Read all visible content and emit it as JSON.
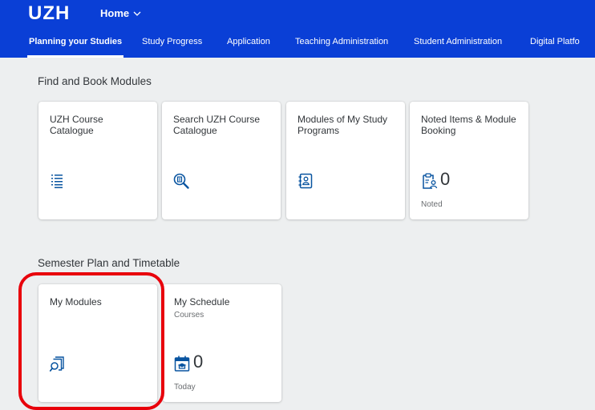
{
  "shell": {
    "logo": "UZH",
    "home_label": "Home"
  },
  "tabs": [
    {
      "label": "Planning your Studies",
      "active": true
    },
    {
      "label": "Study Progress"
    },
    {
      "label": "Application"
    },
    {
      "label": "Teaching Administration"
    },
    {
      "label": "Student Administration"
    },
    {
      "label": "Digital Platfo"
    }
  ],
  "sections": [
    {
      "title": "Find and Book Modules",
      "tiles": [
        {
          "title": "UZH Course Catalogue",
          "icon": "list-icon"
        },
        {
          "title": "Search UZH Course Catalogue",
          "icon": "search-document-icon"
        },
        {
          "title": "Modules of My Study Programs",
          "icon": "address-book-icon"
        },
        {
          "title": "Noted Items & Module Booking",
          "icon": "clipboard-user-icon",
          "number": "0",
          "footer": "Noted"
        }
      ]
    },
    {
      "title": "Semester Plan and Timetable",
      "tiles": [
        {
          "title": "My Modules",
          "icon": "module-search-icon"
        },
        {
          "title": "My Schedule",
          "subtitle": "Courses",
          "icon": "calendar-education-icon",
          "number": "0",
          "footer": "Today"
        }
      ]
    }
  ],
  "colors": {
    "brand": "#0a3fd6",
    "background": "#edeff0",
    "icon": "#0854a0",
    "highlight": "#e8000b"
  }
}
